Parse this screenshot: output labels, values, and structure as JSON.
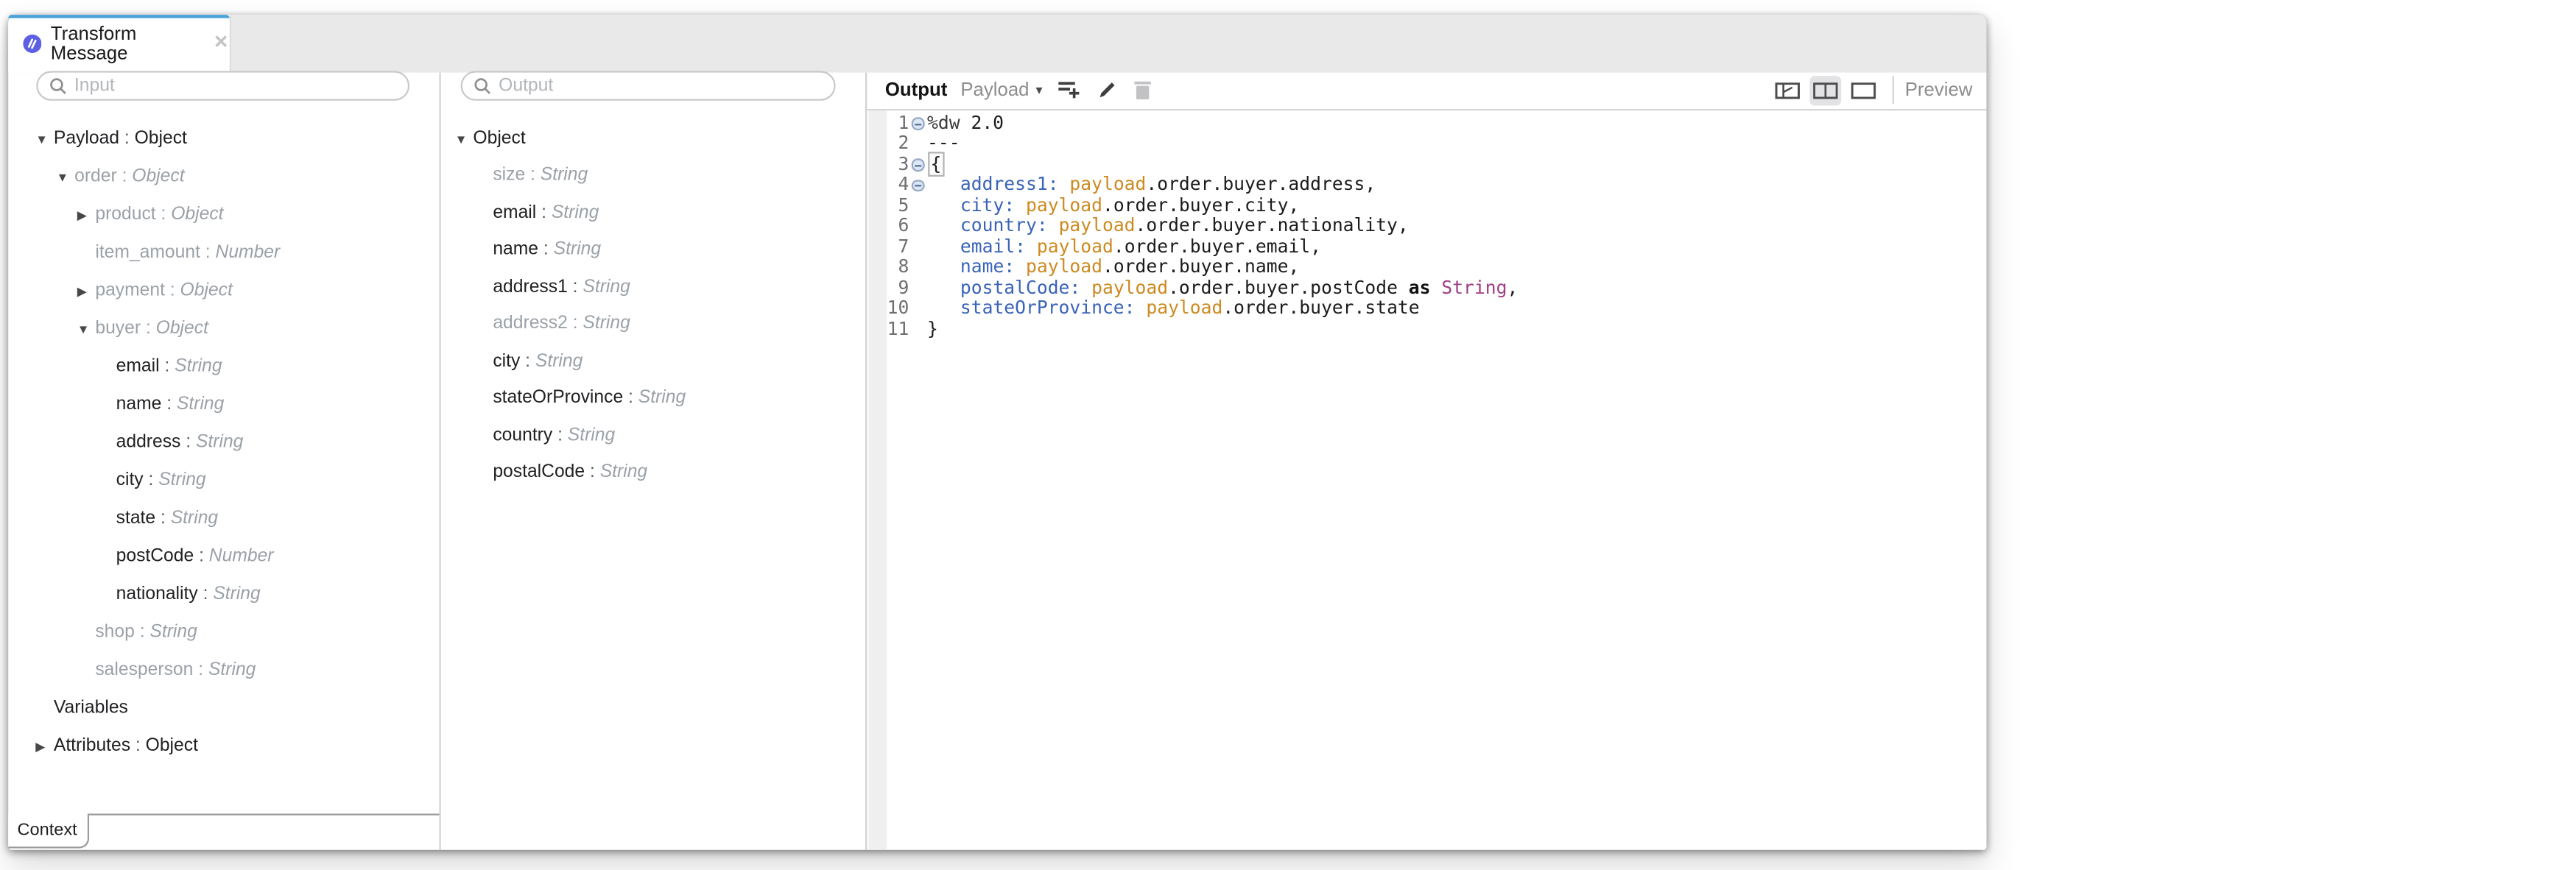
{
  "tab": {
    "title": "Transform Message",
    "close_glyph": "✕"
  },
  "colors": {
    "accent_tab": "#4aa3d8",
    "dataweave_icon": "#5d60e2",
    "code_key": "#3a63b8",
    "code_payload": "#cd8a21",
    "code_type": "#a13c82"
  },
  "input_panel": {
    "search_placeholder": "Input",
    "context_label": "Context",
    "tree": [
      {
        "label": "Payload",
        "type": "Object",
        "arrow": "down",
        "level": 0,
        "dim": false,
        "type_plain": true
      },
      {
        "label": "order",
        "type": "Object",
        "arrow": "down",
        "level": 1,
        "dim": true
      },
      {
        "label": "product",
        "type": "Object",
        "arrow": "right",
        "level": 2,
        "dim": true
      },
      {
        "label": "item_amount",
        "type": "Number",
        "arrow": "none",
        "level": 2,
        "dim": true
      },
      {
        "label": "payment",
        "type": "Object",
        "arrow": "right",
        "level": 2,
        "dim": true
      },
      {
        "label": "buyer",
        "type": "Object",
        "arrow": "down",
        "level": 2,
        "dim": true
      },
      {
        "label": "email",
        "type": "String",
        "arrow": "none",
        "level": 3,
        "dim": false
      },
      {
        "label": "name",
        "type": "String",
        "arrow": "none",
        "level": 3,
        "dim": false
      },
      {
        "label": "address",
        "type": "String",
        "arrow": "none",
        "level": 3,
        "dim": false
      },
      {
        "label": "city",
        "type": "String",
        "arrow": "none",
        "level": 3,
        "dim": false
      },
      {
        "label": "state",
        "type": "String",
        "arrow": "none",
        "level": 3,
        "dim": false
      },
      {
        "label": "postCode",
        "type": "Number",
        "arrow": "none",
        "level": 3,
        "dim": false
      },
      {
        "label": "nationality",
        "type": "String",
        "arrow": "none",
        "level": 3,
        "dim": false
      },
      {
        "label": "shop",
        "type": "String",
        "arrow": "none",
        "level": 2,
        "dim": true
      },
      {
        "label": "salesperson",
        "type": "String",
        "arrow": "none",
        "level": 2,
        "dim": true
      },
      {
        "label": "Variables",
        "type": null,
        "arrow": "none",
        "level": 0,
        "dim": false
      },
      {
        "label": "Attributes",
        "type": "Object",
        "arrow": "right",
        "level": 0,
        "dim": false,
        "type_plain": true
      }
    ]
  },
  "output_panel": {
    "search_placeholder": "Output",
    "tree": [
      {
        "label": "Object",
        "type": null,
        "arrow": "down",
        "level": 0,
        "dim": false
      },
      {
        "label": "size",
        "type": "String",
        "arrow": "none",
        "level": 1,
        "dim": true
      },
      {
        "label": "email",
        "type": "String",
        "arrow": "none",
        "level": 1,
        "dim": false
      },
      {
        "label": "name",
        "type": "String",
        "arrow": "none",
        "level": 1,
        "dim": false
      },
      {
        "label": "address1",
        "type": "String",
        "arrow": "none",
        "level": 1,
        "dim": false
      },
      {
        "label": "address2",
        "type": "String",
        "arrow": "none",
        "level": 1,
        "dim": true
      },
      {
        "label": "city",
        "type": "String",
        "arrow": "none",
        "level": 1,
        "dim": false
      },
      {
        "label": "stateOrProvince",
        "type": "String",
        "arrow": "none",
        "level": 1,
        "dim": false
      },
      {
        "label": "country",
        "type": "String",
        "arrow": "none",
        "level": 1,
        "dim": false
      },
      {
        "label": "postalCode",
        "type": "String",
        "arrow": "none",
        "level": 1,
        "dim": false
      }
    ]
  },
  "editor": {
    "header": {
      "title": "Output",
      "target": "Payload",
      "caret": "▾"
    },
    "preview_label": "Preview",
    "lines": [
      {
        "num": "1",
        "fold": true,
        "indent": false,
        "tokens": [
          [
            "dir",
            "%dw"
          ],
          [
            "d",
            " 2.0"
          ]
        ]
      },
      {
        "num": "2",
        "fold": false,
        "indent": false,
        "tokens": [
          [
            "d",
            "---"
          ]
        ]
      },
      {
        "num": "3",
        "fold": true,
        "indent": false,
        "tokens": [
          [
            "brk",
            "{"
          ]
        ]
      },
      {
        "num": "4",
        "fold": true,
        "indent": true,
        "tokens": [
          [
            "key",
            "address1:"
          ],
          [
            "d",
            " "
          ],
          [
            "pay",
            "payload"
          ],
          [
            "d",
            ".order.buyer.address,"
          ]
        ]
      },
      {
        "num": "5",
        "fold": false,
        "indent": true,
        "tokens": [
          [
            "key",
            "city:"
          ],
          [
            "d",
            " "
          ],
          [
            "pay",
            "payload"
          ],
          [
            "d",
            ".order.buyer.city,"
          ]
        ]
      },
      {
        "num": "6",
        "fold": false,
        "indent": true,
        "tokens": [
          [
            "key",
            "country:"
          ],
          [
            "d",
            " "
          ],
          [
            "pay",
            "payload"
          ],
          [
            "d",
            ".order.buyer.nationality,"
          ]
        ]
      },
      {
        "num": "7",
        "fold": false,
        "indent": true,
        "tokens": [
          [
            "key",
            "email:"
          ],
          [
            "d",
            " "
          ],
          [
            "pay",
            "payload"
          ],
          [
            "d",
            ".order.buyer.email,"
          ]
        ]
      },
      {
        "num": "8",
        "fold": false,
        "indent": true,
        "tokens": [
          [
            "key",
            "name:"
          ],
          [
            "d",
            " "
          ],
          [
            "pay",
            "payload"
          ],
          [
            "d",
            ".order.buyer.name,"
          ]
        ]
      },
      {
        "num": "9",
        "fold": false,
        "indent": true,
        "tokens": [
          [
            "key",
            "postalCode:"
          ],
          [
            "d",
            " "
          ],
          [
            "pay",
            "payload"
          ],
          [
            "d",
            ".order.buyer.postCode "
          ],
          [
            "kw",
            "as"
          ],
          [
            "str",
            " String"
          ],
          [
            "d",
            ","
          ]
        ]
      },
      {
        "num": "10",
        "fold": false,
        "indent": true,
        "tokens": [
          [
            "key",
            "stateOrProvince:"
          ],
          [
            "d",
            " "
          ],
          [
            "pay",
            "payload"
          ],
          [
            "d",
            ".order.buyer.state"
          ]
        ]
      },
      {
        "num": "11",
        "fold": false,
        "indent": false,
        "tokens": [
          [
            "d",
            "}"
          ]
        ]
      }
    ]
  }
}
